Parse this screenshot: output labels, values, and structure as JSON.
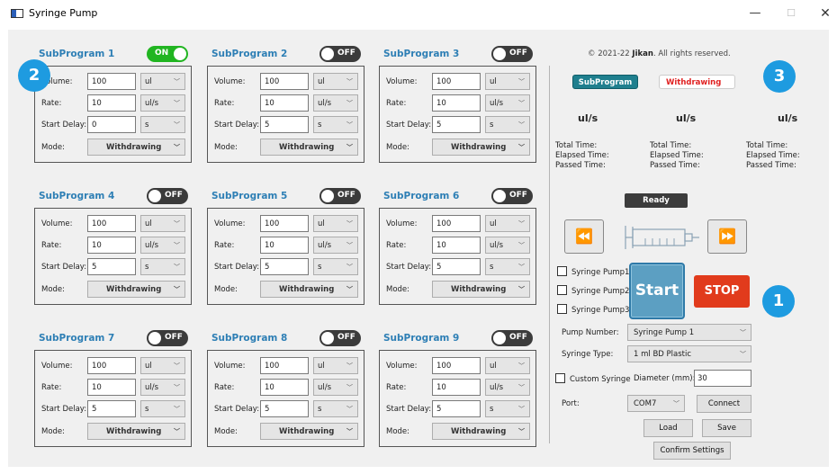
{
  "window": {
    "title": "Syringe Pump",
    "minimize": "—",
    "maximize": "☐",
    "close": "✕"
  },
  "subprograms": [
    {
      "title": "SubProgram 1",
      "toggle": "ON",
      "state": "on",
      "volume": "100",
      "volume_unit": "ul",
      "rate": "10",
      "rate_unit": "ul/s",
      "start_delay": "0",
      "delay_unit": "s",
      "mode": "Withdrawing"
    },
    {
      "title": "SubProgram 2",
      "toggle": "OFF",
      "state": "off",
      "volume": "100",
      "volume_unit": "ul",
      "rate": "10",
      "rate_unit": "ul/s",
      "start_delay": "5",
      "delay_unit": "s",
      "mode": "Withdrawing"
    },
    {
      "title": "SubProgram 3",
      "toggle": "OFF",
      "state": "off",
      "volume": "100",
      "volume_unit": "ul",
      "rate": "10",
      "rate_unit": "ul/s",
      "start_delay": "5",
      "delay_unit": "s",
      "mode": "Withdrawing"
    },
    {
      "title": "SubProgram 4",
      "toggle": "OFF",
      "state": "off",
      "volume": "100",
      "volume_unit": "ul",
      "rate": "10",
      "rate_unit": "ul/s",
      "start_delay": "5",
      "delay_unit": "s",
      "mode": "Withdrawing"
    },
    {
      "title": "SubProgram 5",
      "toggle": "OFF",
      "state": "off",
      "volume": "100",
      "volume_unit": "ul",
      "rate": "10",
      "rate_unit": "ul/s",
      "start_delay": "5",
      "delay_unit": "s",
      "mode": "Withdrawing"
    },
    {
      "title": "SubProgram 6",
      "toggle": "OFF",
      "state": "off",
      "volume": "100",
      "volume_unit": "ul",
      "rate": "10",
      "rate_unit": "ul/s",
      "start_delay": "5",
      "delay_unit": "s",
      "mode": "Withdrawing"
    },
    {
      "title": "SubProgram 7",
      "toggle": "OFF",
      "state": "off",
      "volume": "100",
      "volume_unit": "ul",
      "rate": "10",
      "rate_unit": "ul/s",
      "start_delay": "5",
      "delay_unit": "s",
      "mode": "Withdrawing"
    },
    {
      "title": "SubProgram 8",
      "toggle": "OFF",
      "state": "off",
      "volume": "100",
      "volume_unit": "ul",
      "rate": "10",
      "rate_unit": "ul/s",
      "start_delay": "5",
      "delay_unit": "s",
      "mode": "Withdrawing"
    },
    {
      "title": "SubProgram 9",
      "toggle": "OFF",
      "state": "off",
      "volume": "100",
      "volume_unit": "ul",
      "rate": "10",
      "rate_unit": "ul/s",
      "start_delay": "5",
      "delay_unit": "s",
      "mode": "Withdrawing"
    }
  ],
  "labels": {
    "volume": "Volume:",
    "rate": "Rate:",
    "start_delay": "Start Delay:",
    "mode": "Mode:"
  },
  "badges": {
    "b1": "1",
    "b2": "2",
    "b3": "3"
  },
  "status_panel": {
    "copyright_prefix": "© 2021-22 ",
    "copyright_brand": "Jikan",
    "copyright_suffix": ". All rights reserved.",
    "subprogram_pill": "SubProgram",
    "direction_pill": "Withdrawing",
    "units": [
      "ul/s",
      "ul/s",
      "ul/s"
    ],
    "total_time": "Total Time:",
    "elapsed_time": "Elapsed Time:",
    "passed_time": "Passed Time:",
    "status": "Ready"
  },
  "controls": {
    "rewind_icon": "⏪",
    "forward_icon": "⏩",
    "pumps": [
      "Syringe Pump1",
      "Syringe Pump2",
      "Syringe Pump3"
    ],
    "start": "Start",
    "stop": "STOP",
    "pump_number_label": "Pump Number:",
    "pump_number_value": "Syringe Pump 1",
    "syringe_type_label": "Syringe Type:",
    "syringe_type_value": "1 ml BD Plastic",
    "custom_syringe": "Custom Syringe",
    "diameter_label": "Diameter (mm):",
    "diameter_value": "30",
    "port_label": "Port:",
    "port_value": "COM7",
    "connect": "Connect",
    "load": "Load",
    "save": "Save",
    "confirm": "Confirm Settings"
  },
  "colors": {
    "accent": "#2e7fb5",
    "badge": "#1e9be0",
    "on": "#21b521",
    "stop": "#e13b1c",
    "start": "#5c9fc2"
  }
}
